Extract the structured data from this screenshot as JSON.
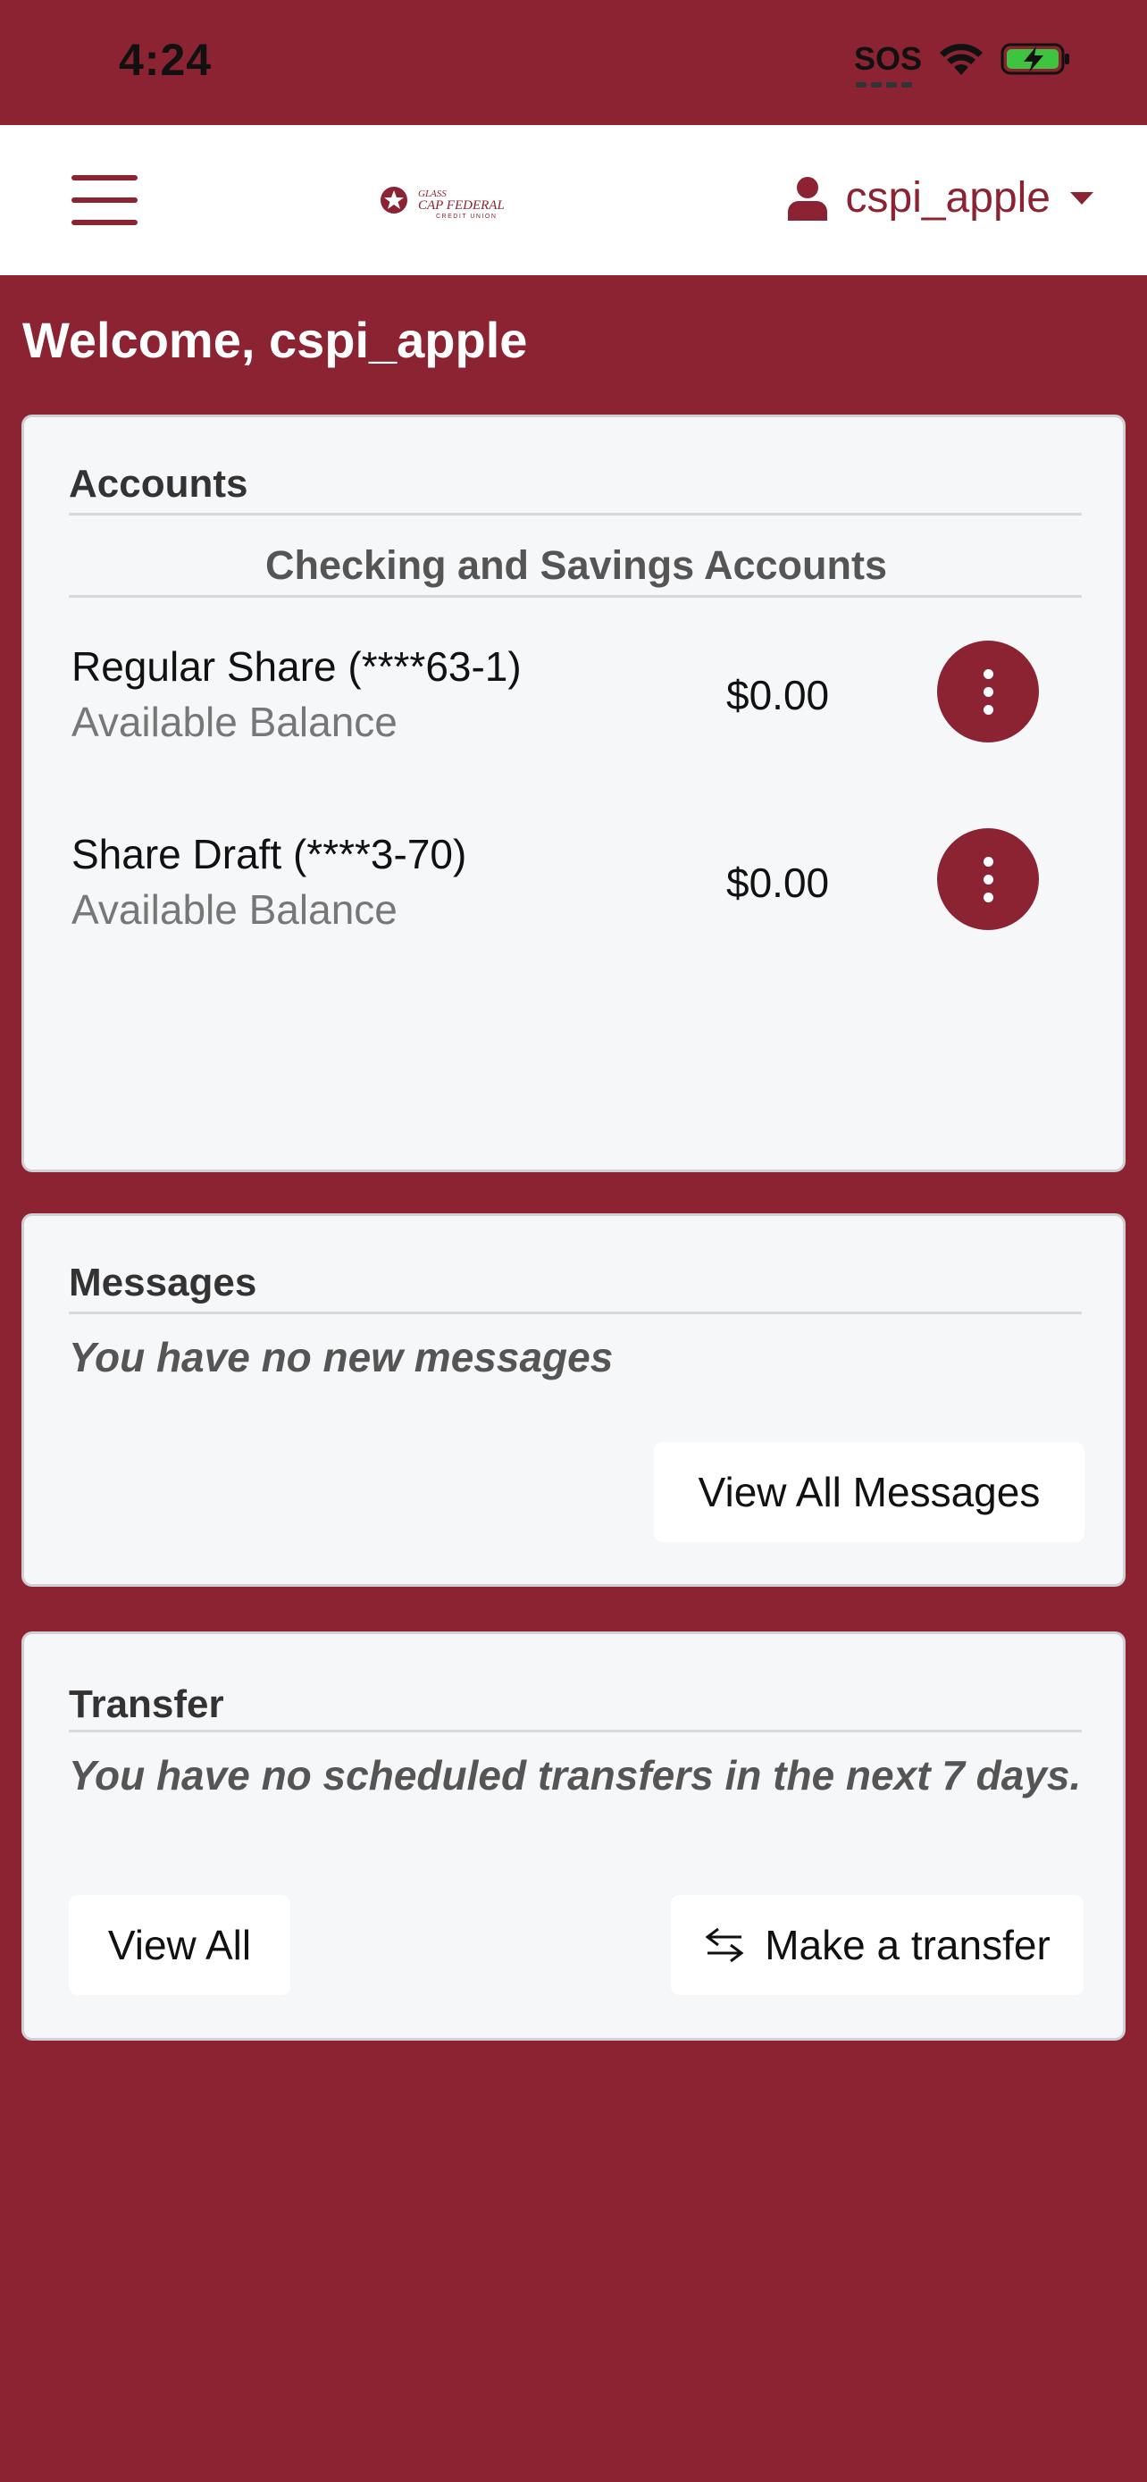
{
  "status": {
    "time": "4:24",
    "sos": "SOS"
  },
  "nav": {
    "logo_line1": "GLASS",
    "logo_line2": "CAP FEDERAL",
    "logo_line3": "CREDIT UNION",
    "username": "cspi_apple"
  },
  "welcome": "Welcome, cspi_apple",
  "accounts": {
    "title": "Accounts",
    "section": "Checking and Savings Accounts",
    "items": [
      {
        "name": "Regular Share (****63-1)",
        "sub": "Available Balance",
        "amount": "$0.00"
      },
      {
        "name": "Share Draft (****3-70)",
        "sub": "Available Balance",
        "amount": "$0.00"
      }
    ]
  },
  "messages": {
    "title": "Messages",
    "note": "You have no new messages",
    "button": "View All Messages"
  },
  "transfer": {
    "title": "Transfer",
    "note": "You have no scheduled transfers in the next 7 days.",
    "view_all": "View All",
    "make": "Make a transfer"
  },
  "colors": {
    "brand": "#8b2332",
    "battery": "#3fc43f"
  },
  "icons": [
    "menu-icon",
    "logo-star-icon",
    "user-icon",
    "caret-down-icon",
    "kebab-icon",
    "transfer-arrows-icon",
    "wifi-icon",
    "battery-icon"
  ]
}
